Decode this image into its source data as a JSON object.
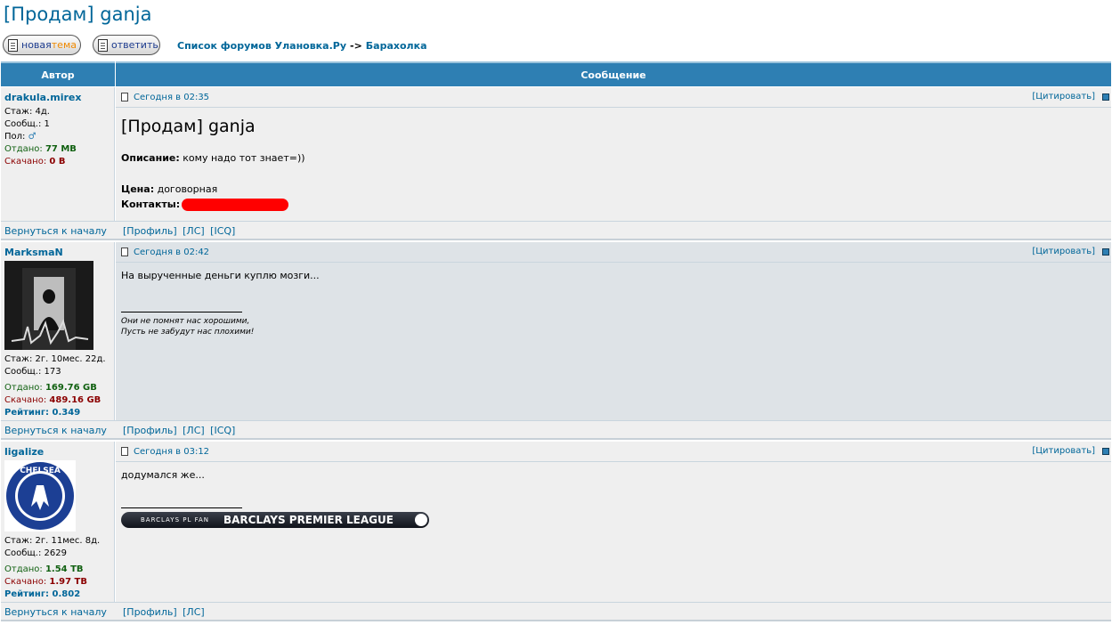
{
  "topic": {
    "title": "[Продам] ganja"
  },
  "toolbar": {
    "new_topic_word1": "новая",
    "new_topic_word2": "тема",
    "reply_label": "ответить"
  },
  "breadcrumb": {
    "forum_list": "Список форумов Улановка.Ру",
    "separator": "->",
    "section": "Барахолка"
  },
  "table_header": {
    "author": "Автор",
    "message": "Сообщение"
  },
  "posts": [
    {
      "author": "drakula.mirex",
      "stazh": "Стаж: 4д.",
      "soobsh": "Сообщ.: 1",
      "pol": "Пол:",
      "otdano_label": "Отдано:",
      "otdano_value": "77 MB",
      "skachano_label": "Скачано:",
      "skachano_value": "0 B",
      "time": "Сегодня в 02:35",
      "quote_label": "[Цитировать]",
      "body_title": "[Продам] ganja",
      "desc_label": "Описание:",
      "desc_value": "кому надо тот знает=))",
      "price_label": "Цена:",
      "price_value": "договорная",
      "contacts_label": "Контакты:",
      "links": "[Профиль] [ЛС] [ICQ]",
      "back": "Вернуться к началу"
    },
    {
      "author": "MarksmaN",
      "stazh": "Стаж: 2г. 10мес. 22д.",
      "soobsh": "Сообщ.: 173",
      "otdano_label": "Отдано:",
      "otdano_value": "169.76 GB",
      "skachano_label": "Скачано:",
      "skachano_value": "489.16 GB",
      "rating": "Рейтинг: 0.349",
      "time": "Сегодня в 02:42",
      "quote_label": "[Цитировать]",
      "body_text": "На вырученные деньги куплю мозги...",
      "sig_line1": "Они не помнят нас хорошими,",
      "sig_line2": "Пусть не забудут нас плохими!",
      "links": "[Профиль] [ЛС] [ICQ]",
      "back": "Вернуться к началу"
    },
    {
      "author": "ligalize",
      "stazh": "Стаж: 2г. 11мес. 8д.",
      "soobsh": "Сообщ.: 2629",
      "otdano_label": "Отдано:",
      "otdano_value": "1.54 TB",
      "skachano_label": "Скачано:",
      "skachano_value": "1.97 TB",
      "rating": "Рейтинг: 0.802",
      "time": "Сегодня в 03:12",
      "quote_label": "[Цитировать]",
      "body_text": "додумался же...",
      "banner_small": "BARCLAYS PL FAN",
      "banner_big": "BARCLAYS PREMIER LEAGUE",
      "avatar_logo_text": "CHELSEA FOOTBALL CLUB",
      "links": "[Профиль] [ЛС]",
      "back": "Вернуться к началу"
    }
  ]
}
